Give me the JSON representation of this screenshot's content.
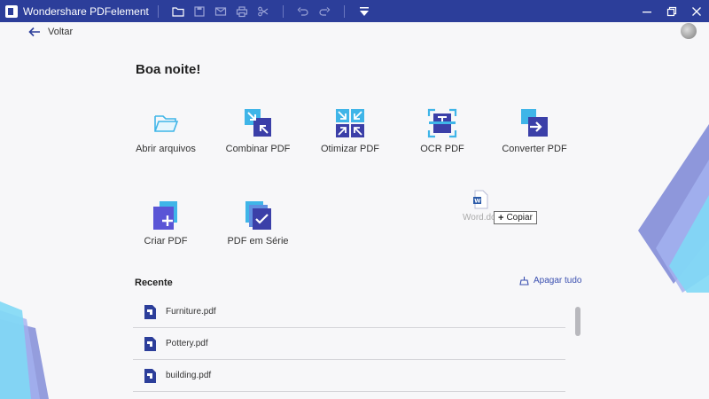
{
  "titlebar": {
    "app_title": "Wondershare PDFelement",
    "icons": [
      "folder-icon",
      "save-icon",
      "mail-icon",
      "print-icon",
      "share-icon",
      "undo-icon",
      "redo-icon",
      "dropdown-menu-icon"
    ],
    "window_controls": [
      "minimize-icon",
      "restore-icon",
      "close-icon"
    ],
    "bg_color": "#2c3e9a"
  },
  "back": {
    "label": "Voltar"
  },
  "greeting": "Boa noite!",
  "tools": [
    {
      "label": "Abrir arquivos",
      "icon": "open-folder-icon"
    },
    {
      "label": "Combinar PDF",
      "icon": "combine-pdf-icon"
    },
    {
      "label": "Otimizar PDF",
      "icon": "optimize-pdf-icon"
    },
    {
      "label": "OCR PDF",
      "icon": "ocr-pdf-icon"
    },
    {
      "label": "Converter PDF",
      "icon": "convert-pdf-icon"
    },
    {
      "label": "Criar PDF",
      "icon": "create-pdf-icon"
    },
    {
      "label": "PDF em Série",
      "icon": "batch-pdf-icon"
    }
  ],
  "drag": {
    "file_name": "Word.do",
    "copy_label": "Copiar"
  },
  "recent": {
    "title": "Recente",
    "clear_label": "Apagar tudo",
    "files": [
      "Furniture.pdf",
      "Pottery.pdf",
      "building.pdf"
    ]
  },
  "colors": {
    "accent": "#3a4fb0",
    "icon_dark": "#3b3fa8",
    "icon_light": "#3fb5e8"
  }
}
